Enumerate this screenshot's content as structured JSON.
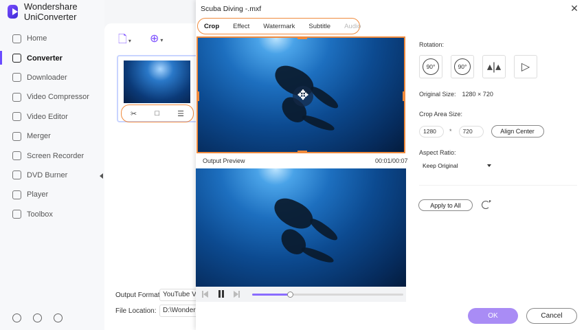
{
  "app": {
    "title": "Wondershare UniConverter"
  },
  "sidebar": {
    "items": [
      {
        "label": "Home",
        "icon": "home-icon"
      },
      {
        "label": "Converter",
        "icon": "converter-icon",
        "active": true
      },
      {
        "label": "Downloader",
        "icon": "downloader-icon"
      },
      {
        "label": "Video Compressor",
        "icon": "compress-icon"
      },
      {
        "label": "Video Editor",
        "icon": "scissors-icon"
      },
      {
        "label": "Merger",
        "icon": "merge-icon"
      },
      {
        "label": "Screen Recorder",
        "icon": "record-icon"
      },
      {
        "label": "DVD Burner",
        "icon": "disc-icon"
      },
      {
        "label": "Player",
        "icon": "play-icon"
      },
      {
        "label": "Toolbox",
        "icon": "grid-icon"
      }
    ],
    "bottom_icons": [
      "help-icon",
      "bell-icon",
      "feedback-icon"
    ]
  },
  "workarea": {
    "output_format_label": "Output Format:",
    "output_format_value": "YouTube Vide",
    "file_location_label": "File Location:",
    "file_location_value": "D:\\Wondersh"
  },
  "dialog": {
    "title": "Scuba Diving -.mxf",
    "tabs": [
      {
        "label": "Crop",
        "state": "active"
      },
      {
        "label": "Effect",
        "state": "normal"
      },
      {
        "label": "Watermark",
        "state": "normal"
      },
      {
        "label": "Subtitle",
        "state": "normal"
      },
      {
        "label": "Audio",
        "state": "disabled"
      }
    ],
    "preview": {
      "label": "Output Preview",
      "time": "00:01/00:07",
      "progress": 0.25
    },
    "settings": {
      "rotation_label": "Rotation:",
      "rotate_ccw": "90°",
      "rotate_cw": "90°",
      "original_size_label": "Original Size:",
      "original_size_value": "1280 × 720",
      "crop_area_label": "Crop Area Size:",
      "crop_width": "1280",
      "crop_times": "*",
      "crop_height": "720",
      "align_center": "Align Center",
      "aspect_label": "Aspect Ratio:",
      "aspect_value": "Keep Original",
      "apply_all": "Apply to All"
    },
    "ok": "OK",
    "cancel": "Cancel"
  },
  "colors": {
    "accent": "#6a4cff",
    "highlight": "#f08a3c",
    "ok_button": "#a98cf5"
  }
}
